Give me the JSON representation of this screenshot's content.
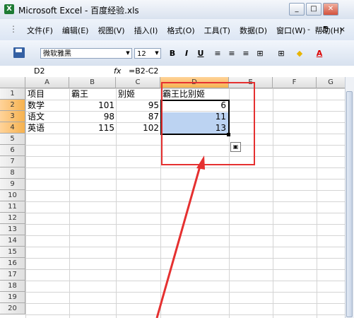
{
  "window": {
    "title": "Microsoft Excel - 百度经验.xls",
    "app_icon": "X",
    "min": "_",
    "max": "□",
    "close": "✕"
  },
  "menu": {
    "items": [
      "文件(F)",
      "编辑(E)",
      "视图(V)",
      "插入(I)",
      "格式(O)",
      "工具(T)",
      "数据(D)",
      "窗口(W)",
      "帮助(H)"
    ],
    "doc_controls": "- ♬ ×"
  },
  "toolbar": {
    "font": "微软雅黑",
    "size": "12",
    "bold": "B",
    "italic": "I",
    "underline": "U"
  },
  "formula_bar": {
    "name_box": "D2",
    "fx": "fx",
    "formula": "=B2-C2"
  },
  "columns": [
    "A",
    "B",
    "C",
    "D",
    "E",
    "F",
    "G"
  ],
  "rows": [
    "1",
    "2",
    "3",
    "4",
    "5",
    "6",
    "7",
    "8",
    "9",
    "10",
    "11",
    "12",
    "13",
    "14",
    "15",
    "16",
    "17",
    "18",
    "19",
    "20"
  ],
  "cells": {
    "A1": "项目",
    "B1": "霸王",
    "C1": "别姬",
    "D1": "霸王比别姬",
    "A2": "数学",
    "B2": "101",
    "C2": "95",
    "D2": "6",
    "A3": "语文",
    "B3": "98",
    "C3": "87",
    "D3": "11",
    "A4": "英语",
    "B4": "115",
    "C4": "102",
    "D4": "13"
  },
  "colors": {
    "selection": "#bcd3f2",
    "annotation": "#e53030",
    "header_selected": "#f6b24f"
  },
  "icons": {
    "save": "save-icon",
    "fx": "function-icon",
    "paste_options": "paste-options-icon"
  }
}
